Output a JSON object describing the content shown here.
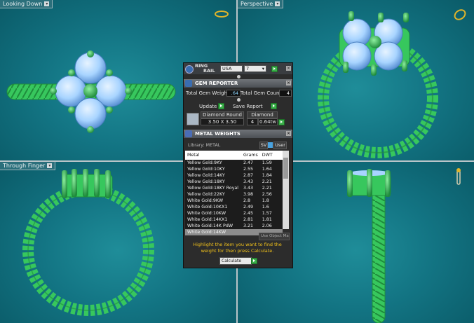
{
  "viewports": {
    "top_left": {
      "label": "Looking Down"
    },
    "top_right": {
      "label": "Perspective"
    },
    "bottom_left": {
      "label": "Through Finger"
    },
    "bottom_right": {
      "label": ""
    }
  },
  "colors": {
    "ring": "#37c75d",
    "ring_dark": "#1f8c3c",
    "gem": "#a8d4ff",
    "gem_dark": "#5e94d6",
    "viewport_bg": "#137584",
    "panel_bg": "#2c2c2c",
    "highlight_text": "#f2c21a",
    "accent_value": "#8fd6ff"
  },
  "panel": {
    "ring_rail": {
      "title_line1": "RING",
      "title_line2": "RAIL",
      "standard": "USA",
      "size": "7"
    },
    "gem_reporter": {
      "title": "GEM REPORTER",
      "total_weight_label": "Total Gem Weight",
      "total_weight_value": ".64",
      "total_count_label": "Total Gem Count",
      "total_count_value": "4",
      "update_label": "Update",
      "save_report_label": "Save Report",
      "columns": [
        "Diamond Round",
        "Diamond"
      ],
      "row": {
        "size": "3.50 X 3.50",
        "count": "4",
        "weight": "0.64tw"
      }
    },
    "metal_weights": {
      "title": "METAL WEIGHTS",
      "library_label": "Library: METAL",
      "toggle_sv": "SV",
      "toggle_user": "User",
      "columns": [
        "Metal",
        "Grams",
        "DWT"
      ],
      "rows": [
        {
          "metal": "Yellow Gold:9KY",
          "grams": "2.47",
          "dwt": "1.59"
        },
        {
          "metal": "Yellow Gold:10KY",
          "grams": "2.55",
          "dwt": "1.64"
        },
        {
          "metal": "Yellow Gold:14KY",
          "grams": "2.87",
          "dwt": "1.84"
        },
        {
          "metal": "Yellow Gold:18KY",
          "grams": "3.43",
          "dwt": "2.21"
        },
        {
          "metal": "Yellow Gold:18KY Royal",
          "grams": "3.43",
          "dwt": "2.21"
        },
        {
          "metal": "Yellow Gold:22KY",
          "grams": "3.98",
          "dwt": "2.56"
        },
        {
          "metal": "White Gold:9KW",
          "grams": "2.8",
          "dwt": "1.8"
        },
        {
          "metal": "White Gold:10KX1",
          "grams": "2.49",
          "dwt": "1.6"
        },
        {
          "metal": "White Gold:10KW",
          "grams": "2.45",
          "dwt": "1.57"
        },
        {
          "metal": "White Gold:14KX1",
          "grams": "2.81",
          "dwt": "1.81"
        },
        {
          "metal": "White Gold:14K PdW",
          "grams": "3.21",
          "dwt": "2.06"
        },
        {
          "metal": "White Gold:14KW",
          "grams": "",
          "dwt": ""
        }
      ],
      "use_object_materials": "Use Object Materials",
      "hint": "Highlight the item you want to find the weight for then press Calculate.",
      "calculate_label": "Calculate"
    }
  }
}
